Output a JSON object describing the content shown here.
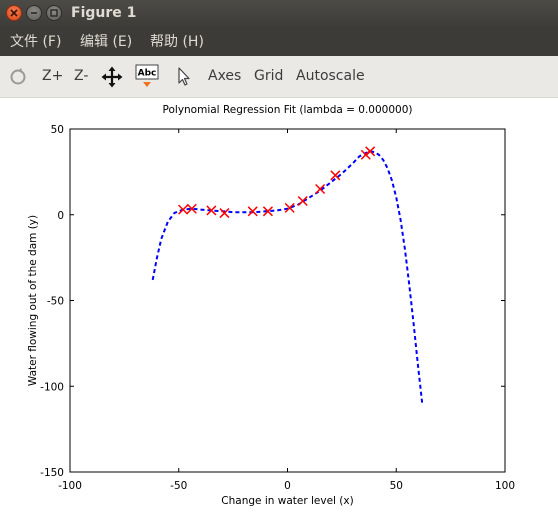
{
  "window": {
    "title": "Figure 1",
    "controls": [
      "close-icon",
      "minimize-icon",
      "maximize-icon"
    ]
  },
  "menu": [
    {
      "label": "文件 (F)"
    },
    {
      "label": "编辑 (E)"
    },
    {
      "label": "帮助 (H)"
    }
  ],
  "toolbar": {
    "rotate_icon": "rotate-icon",
    "zoom_in": "Z+",
    "zoom_out": "Z-",
    "pan_icon": "pan-icon",
    "text_icon_label": "Abc",
    "pointer_icon": "pointer-icon",
    "axes": "Axes",
    "grid": "Grid",
    "autoscale": "Autoscale"
  },
  "colors": {
    "titlebar": "#3d3c38",
    "menubar": "#3c3b37",
    "toolbar": "#ebe9e6",
    "close_button": "#dd4814",
    "fit_line": "#0000ff",
    "markers": "#ff0000"
  },
  "chart_data": {
    "type": "scatter",
    "title": "Polynomial Regression Fit (lambda = 0.000000)",
    "xlabel": "Change in water level (x)",
    "ylabel": "Water flowing out of the dam (y)",
    "xlim": [
      -100,
      100
    ],
    "ylim": [
      -150,
      50
    ],
    "xticks": [
      -100,
      -50,
      0,
      50,
      100
    ],
    "yticks": [
      50,
      0,
      -50,
      -100,
      -150
    ],
    "grid": false,
    "legend": "none",
    "series": [
      {
        "marker": "x",
        "color": "#ff0000",
        "x": [
          -48,
          -44,
          -35,
          -29,
          -16,
          -9,
          1,
          7,
          15,
          22,
          36,
          38
        ],
        "y": [
          3,
          3.5,
          2.5,
          1,
          2,
          2,
          4,
          8,
          15,
          23,
          35,
          37
        ]
      },
      {
        "marker": "line",
        "style": "dashed",
        "color": "#0000ff",
        "x": [
          -62,
          -60,
          -58,
          -55,
          -52,
          -48,
          -44,
          -40,
          -35,
          -30,
          -25,
          -20,
          -15,
          -10,
          -5,
          0,
          5,
          10,
          15,
          20,
          25,
          30,
          33,
          36,
          38,
          40,
          42,
          44,
          46,
          48,
          50,
          52,
          54,
          56,
          58,
          60,
          62
        ],
        "y": [
          -38,
          -25,
          -14,
          -4,
          1,
          3,
          3.5,
          3,
          2.5,
          2,
          1.5,
          1.5,
          1.5,
          2,
          2.5,
          3.5,
          6,
          10,
          14,
          19,
          24,
          30,
          34,
          36,
          37,
          36.5,
          35,
          32,
          27,
          20,
          10,
          -3,
          -20,
          -41,
          -64,
          -88,
          -111
        ]
      }
    ]
  }
}
